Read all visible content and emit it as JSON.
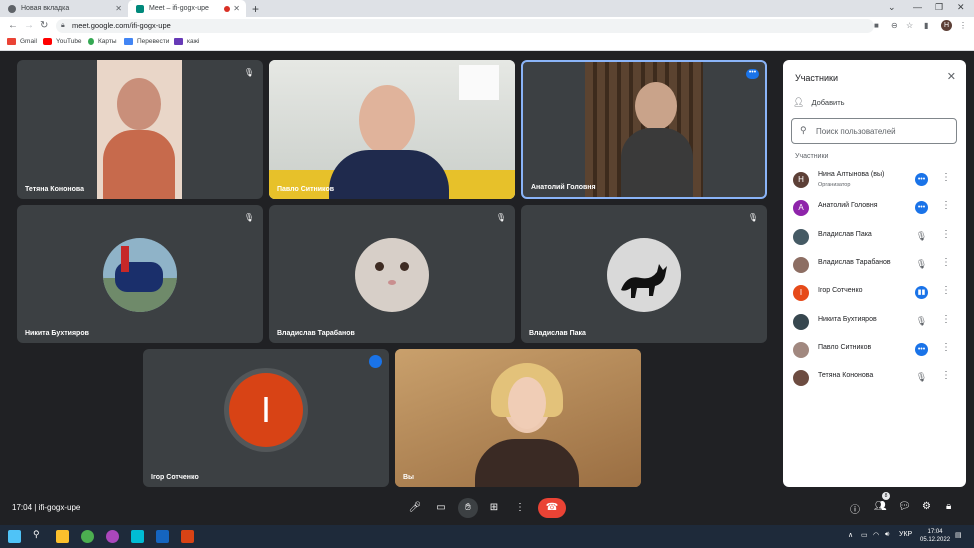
{
  "browser": {
    "tabs": [
      {
        "title": "Новая вкладка"
      },
      {
        "title": "Meet – ifi-gogx-upe"
      }
    ],
    "url": "meet.google.com/ifi-gogx-upe",
    "bookmarks": [
      "Gmail",
      "YouTube",
      "Карты",
      "Перевести",
      "кажі"
    ],
    "profile_initial": "H"
  },
  "tiles": [
    {
      "name": "Тетяна Кононова"
    },
    {
      "name": "Павло Ситников"
    },
    {
      "name": "Анатолий Головня"
    },
    {
      "name": "Никита Бухтияров"
    },
    {
      "name": "Владислав Тарабанов"
    },
    {
      "name": "Владислав Пака"
    },
    {
      "name": "Ігор Сотченко",
      "initial": "I"
    },
    {
      "name": "Вы"
    }
  ],
  "panel": {
    "title": "Участники",
    "add_label": "Добавить",
    "search_placeholder": "Поиск пользователей",
    "section_label": "Участники",
    "people": [
      {
        "name": "Нина Алтынова (вы)",
        "sub": "Организатор",
        "initial": "Н",
        "color": "#5d4037"
      },
      {
        "name": "Анатолий Головня",
        "initial": "А",
        "color": "#8e24aa"
      },
      {
        "name": "Владислав Пака",
        "initial": "",
        "color": "#455a64"
      },
      {
        "name": "Владислав Тарабанов",
        "initial": "",
        "color": "#8d6e63"
      },
      {
        "name": "Ігор Сотченко",
        "initial": "I",
        "color": "#e64a19"
      },
      {
        "name": "Никита Бухтияров",
        "initial": "",
        "color": "#37474f"
      },
      {
        "name": "Павло Ситников",
        "initial": "",
        "color": "#a1887f"
      },
      {
        "name": "Тетяна Кононова",
        "initial": "",
        "color": "#6d4c41"
      }
    ]
  },
  "controls": {
    "time": "17:04",
    "meeting_code": "ifi-gogx-upe",
    "participant_count": "8"
  },
  "taskbar": {
    "lang": "УКР",
    "time": "17:04",
    "date": "05.12.2022"
  }
}
